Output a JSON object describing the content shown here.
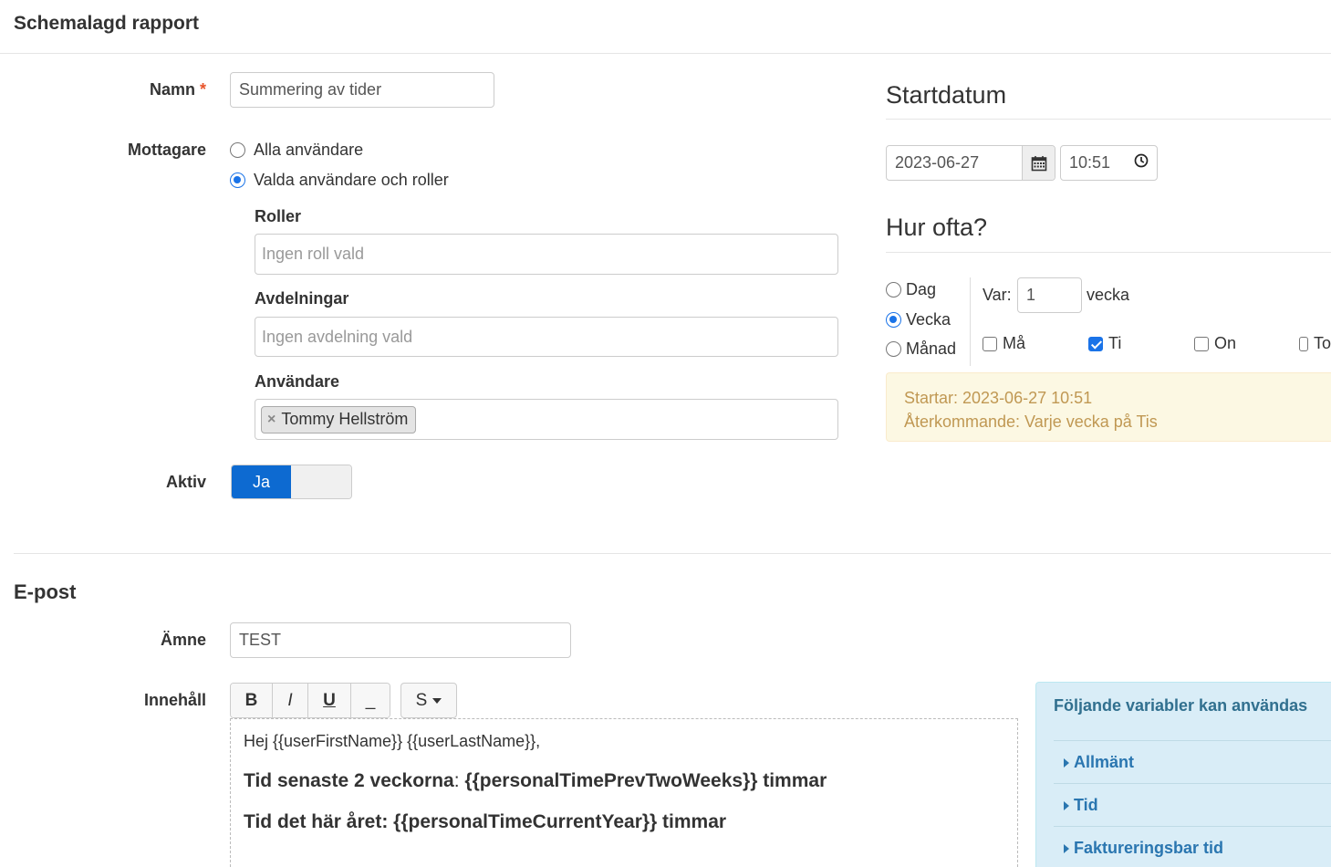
{
  "header": {
    "title": "Schemalagd rapport"
  },
  "form": {
    "name_label": "Namn",
    "required_mark": "*",
    "name_value": "Summering av tider",
    "recipients_label": "Mottagare",
    "recipient_all": "Alla användare",
    "recipient_selected": "Valda användare och roller",
    "roles_label": "Roller",
    "roles_placeholder": "Ingen roll vald",
    "departments_label": "Avdelningar",
    "departments_placeholder": "Ingen avdelning vald",
    "users_label": "Användare",
    "users_tags": [
      "Tommy Hellström"
    ],
    "tag_remove": "×",
    "active_label": "Aktiv",
    "active_value": "Ja"
  },
  "schedule": {
    "start_title": "Startdatum",
    "start_date": "2023-06-27",
    "start_time": "10:51",
    "freq_title": "Hur ofta?",
    "freq_options": [
      "Dag",
      "Vecka",
      "Månad"
    ],
    "freq_selected": "Vecka",
    "every_label": "Var:",
    "every_value": "1",
    "every_unit": "vecka",
    "weekdays": [
      {
        "label": "Må",
        "checked": false
      },
      {
        "label": "Ti",
        "checked": true
      },
      {
        "label": "On",
        "checked": false
      },
      {
        "label": "To",
        "checked": false
      }
    ],
    "summary_start": "Startar: 2023-06-27 10:51",
    "summary_recurring": "Återkommande: Varje vecka på Tis"
  },
  "email": {
    "section_title": "E-post",
    "subject_label": "Ämne",
    "subject_value": "TEST",
    "content_label": "Innehåll",
    "toolbar": {
      "bold": "B",
      "italic": "I",
      "underline": "U",
      "strike": "_",
      "style": "S"
    },
    "body": {
      "greeting": "Hej {{userFirstName}} {{userLastName}},",
      "line1_label": "Tid senaste 2 veckorna",
      "line1_colon": ":",
      "line1_value": "{{personalTimePrevTwoWeeks}} timmar",
      "line2": "Tid det här året: {{personalTimeCurrentYear}} timmar"
    },
    "vars_panel": {
      "title": "Följande variabler kan användas",
      "groups": [
        "Allmänt",
        "Tid",
        "Faktureringsbar tid"
      ]
    }
  },
  "colors": {
    "accent": "#0d6ad1",
    "warning_text": "#c09853",
    "info_bg": "#d9edf7"
  }
}
